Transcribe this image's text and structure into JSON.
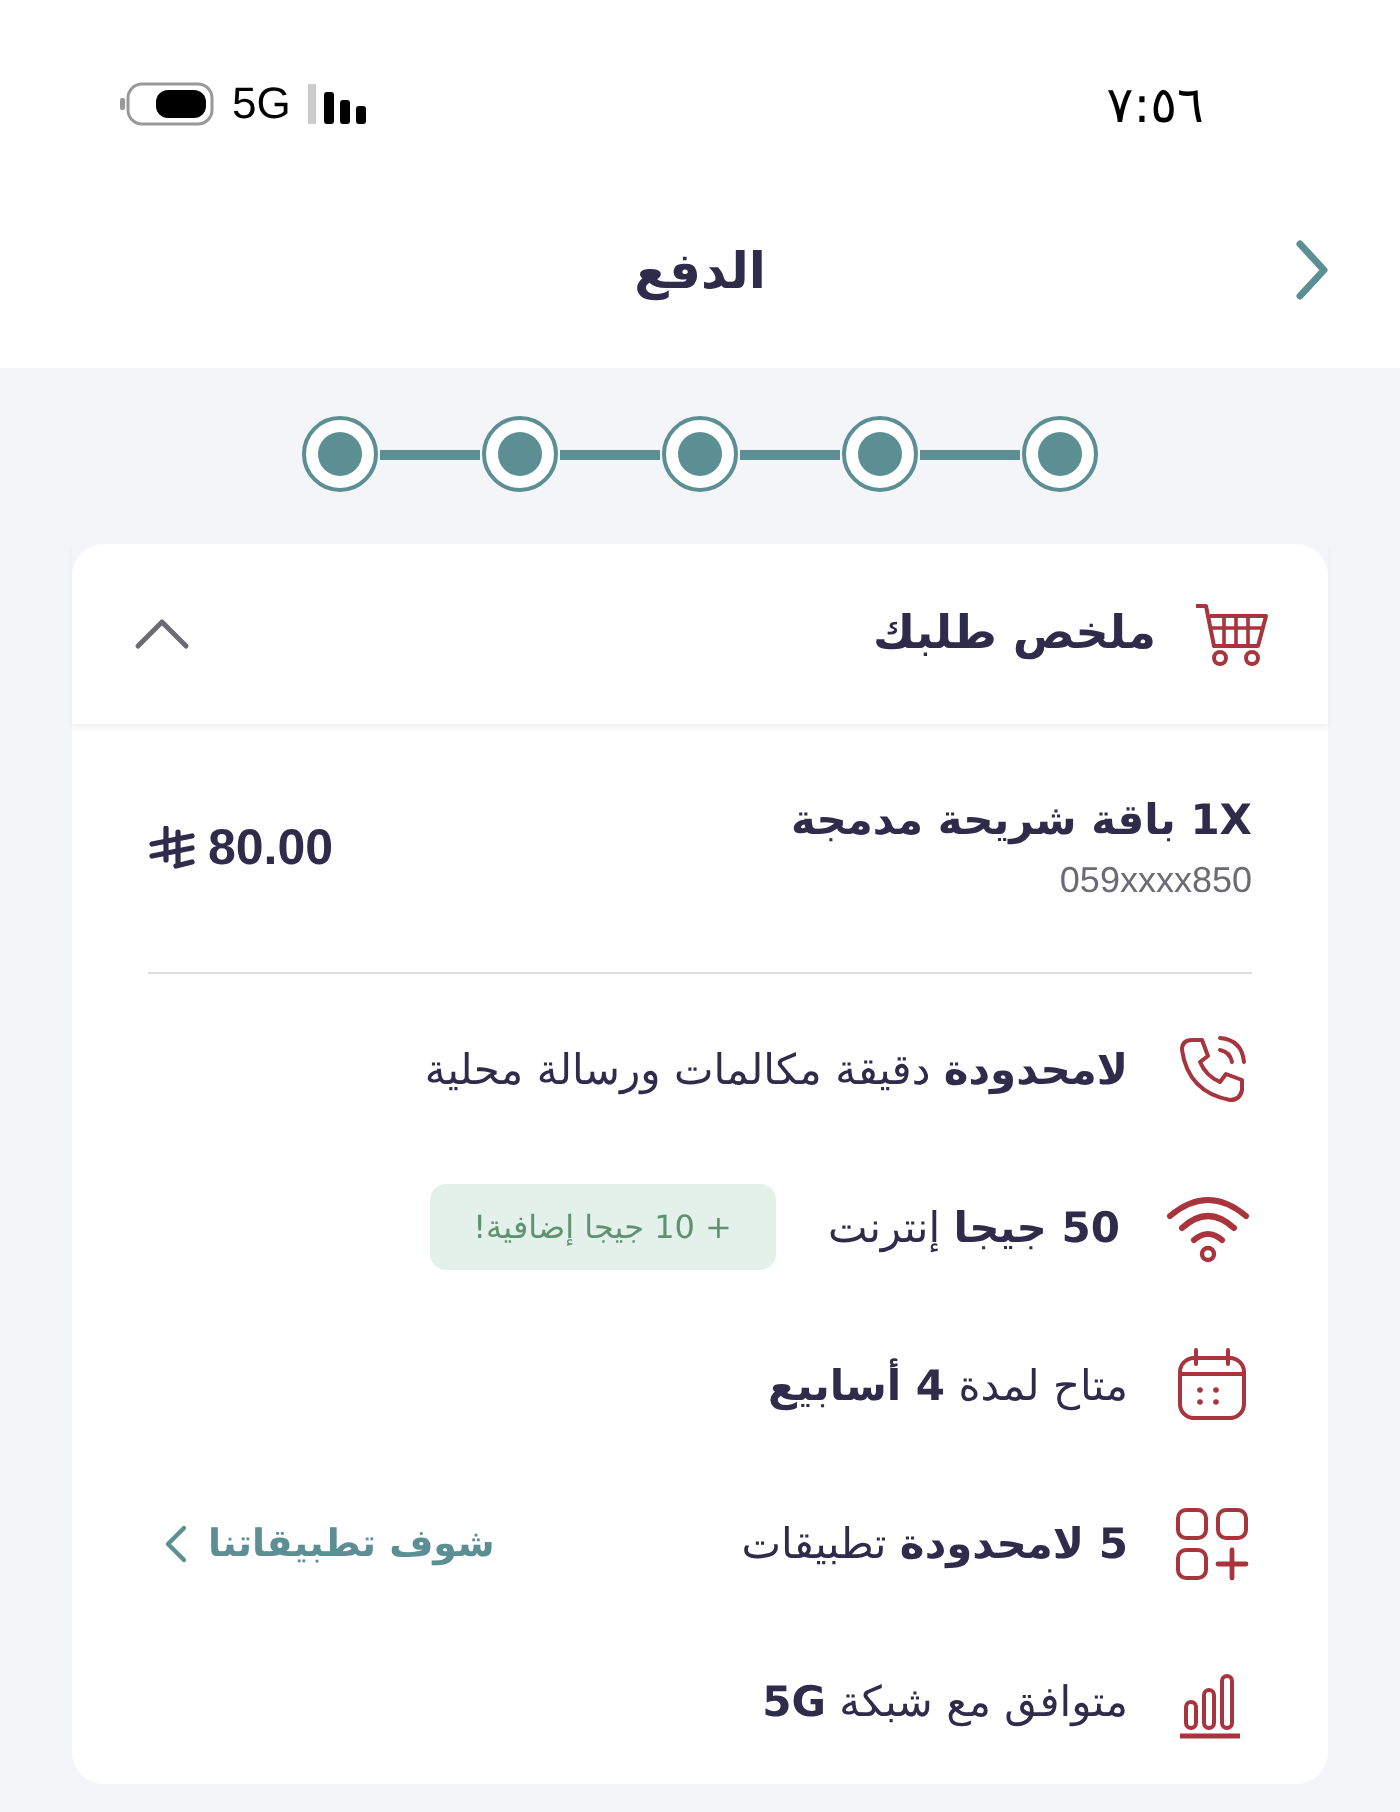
{
  "status_bar": {
    "time": "٧:٥٦",
    "network": "5G"
  },
  "header": {
    "title": "الدفع"
  },
  "steps": [
    {
      "completed": true
    },
    {
      "completed": true
    },
    {
      "completed": true
    },
    {
      "completed": true
    },
    {
      "completed": true
    }
  ],
  "order_summary": {
    "title": "ملخص طلبك",
    "expanded": true,
    "item": {
      "name": "1X باقة شريحة مدمجة",
      "number": "059xxxx850",
      "price": "80.00"
    },
    "features": [
      {
        "kind": "phone",
        "text": "**لامحدودة** دقيقة مكالمات ورسالة محلية"
      },
      {
        "kind": "wifi",
        "text": "**50 جيجا** إنترنت",
        "badge": "+ 10 جيجا إضافية!"
      },
      {
        "kind": "calendar",
        "text": "متاح لمدة **4 أسابيع**"
      },
      {
        "kind": "apps",
        "text": "**5 لامحدودة** تطبيقات",
        "link": "شوف تطبيقاتنا"
      },
      {
        "kind": "bars",
        "text": "متوافق مع شبكة **5G**"
      }
    ]
  }
}
